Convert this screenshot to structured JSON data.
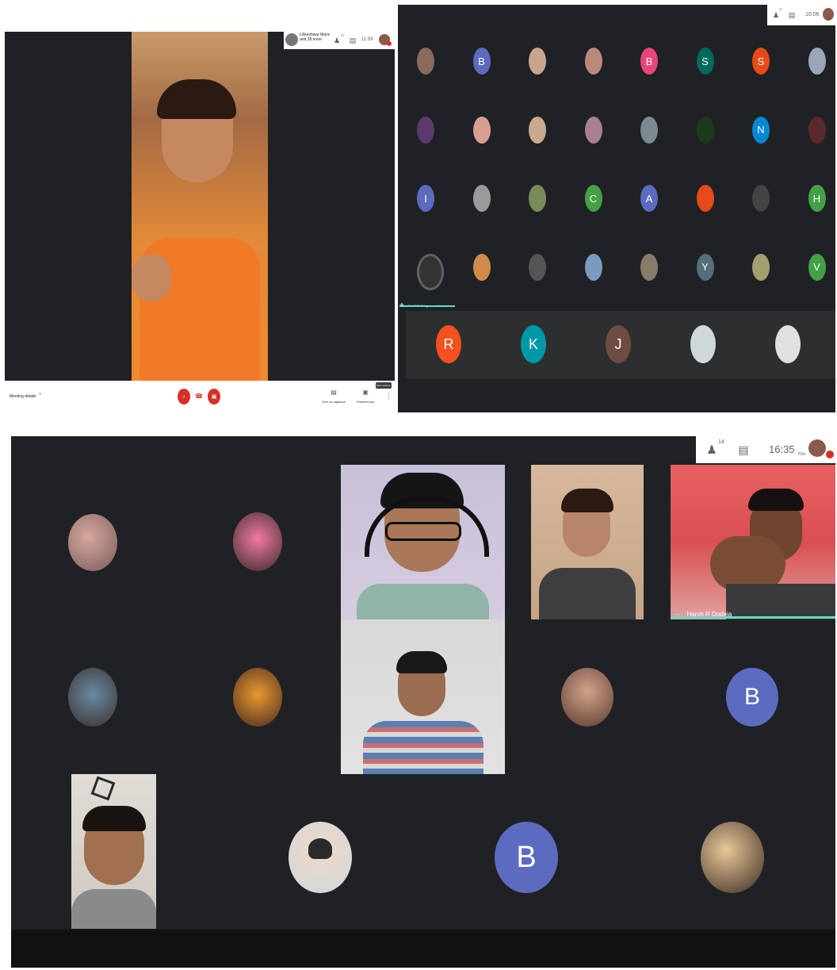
{
  "screenshot1": {
    "top_bar": {
      "presenter": "LAkeshwar Mandlet...",
      "presenter_sub": "and 28 more",
      "people_count": "37",
      "time": "11:59"
    },
    "bottom_bar": {
      "meeting_details": "Meeting details",
      "captions_label": "Turn on captions",
      "present_label": "Present now",
      "more_options_tip": "More options"
    }
  },
  "screenshot2": {
    "top_bar": {
      "people_count": "37",
      "time": "10:06"
    },
    "grid": [
      {
        "letter": "",
        "color": "#8a6a5a"
      },
      {
        "letter": "B",
        "color": "#5c6bc0"
      },
      {
        "letter": "",
        "color": "#c9a48e"
      },
      {
        "letter": "",
        "color": "#b98a7a"
      },
      {
        "letter": "B",
        "color": "#e8457a"
      },
      {
        "letter": "S",
        "color": "#00695c"
      },
      {
        "letter": "S",
        "color": "#e64a19"
      },
      {
        "letter": "",
        "color": "#9aa7b8"
      },
      {
        "letter": "",
        "color": "#5a3a6a"
      },
      {
        "letter": "",
        "color": "#d8a090"
      },
      {
        "letter": "",
        "color": "#caa88e"
      },
      {
        "letter": "",
        "color": "#a88090"
      },
      {
        "letter": "",
        "color": "#7a8a90"
      },
      {
        "letter": "",
        "color": "#1d3a1d"
      },
      {
        "letter": "N",
        "color": "#0288d1"
      },
      {
        "letter": "",
        "color": "#5a2a2a"
      },
      {
        "letter": "I",
        "color": "#5c6bc0"
      },
      {
        "letter": "",
        "color": "#9a9a9a"
      },
      {
        "letter": "",
        "color": "#7a8a5a"
      },
      {
        "letter": "C",
        "color": "#43a047"
      },
      {
        "letter": "A",
        "color": "#5c6bc0"
      },
      {
        "letter": "",
        "color": "#e64a19"
      },
      {
        "letter": "",
        "color": "#444444"
      },
      {
        "letter": "H",
        "color": "#43a047"
      },
      {
        "letter": "",
        "color": "#333333"
      },
      {
        "letter": "",
        "color": "#d08a4a"
      },
      {
        "letter": "",
        "color": "#555555"
      },
      {
        "letter": "",
        "color": "#7a9ac0"
      },
      {
        "letter": "",
        "color": "#8a7a6a"
      },
      {
        "letter": "Y",
        "color": "#546e7a"
      },
      {
        "letter": "",
        "color": "#a0a070"
      },
      {
        "letter": "V",
        "color": "#43a047"
      }
    ],
    "speaker_label": "DHARSHINI gnanasekran",
    "bottom_row": [
      {
        "letter": "R",
        "color": "#f4511e"
      },
      {
        "letter": "K",
        "color": "#0097a7"
      },
      {
        "letter": "J",
        "color": "#6d4c41"
      },
      {
        "letter": "",
        "color": "#cfd8dc"
      },
      {
        "letter": "",
        "color": "#e0e0e0"
      }
    ]
  },
  "screenshot3": {
    "top_bar": {
      "people_count": "14",
      "time": "16:35",
      "you_label": "You"
    },
    "speaker_name": "Harsh R Dodeja",
    "avatar_b1": "B",
    "avatar_b2": "B"
  }
}
